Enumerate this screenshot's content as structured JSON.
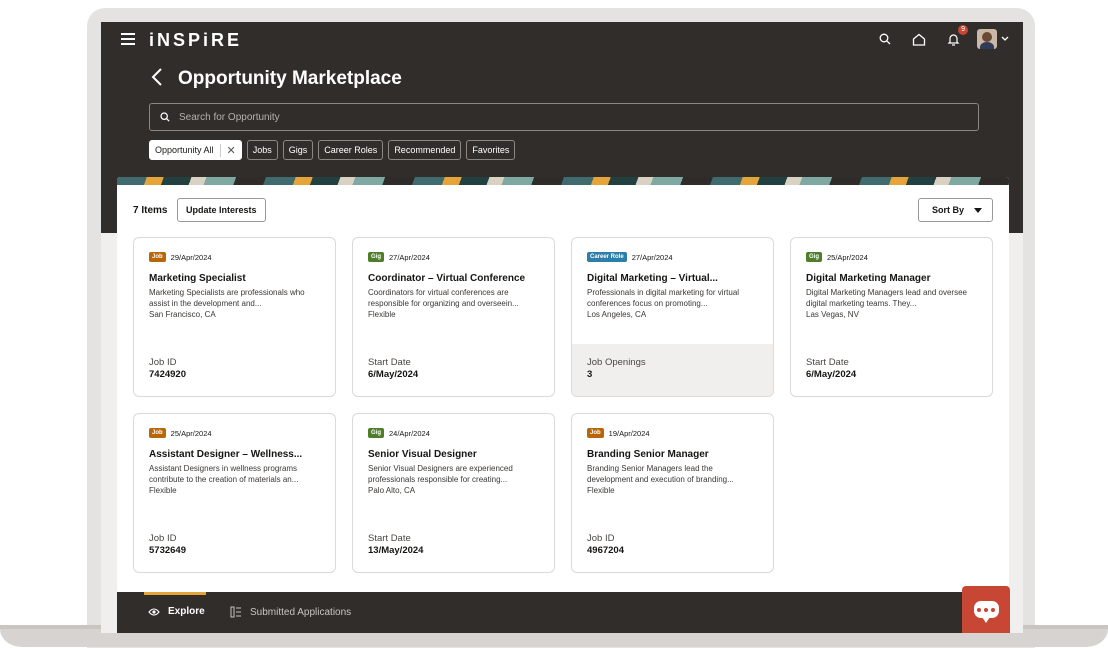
{
  "app": {
    "logo": "iNSPiRE"
  },
  "header": {
    "title": "Opportunity Marketplace",
    "notifications_count": "9"
  },
  "search": {
    "placeholder": "Search for Opportunity"
  },
  "filters": [
    {
      "label": "Opportunity All",
      "active": true
    },
    {
      "label": "Jobs",
      "active": false
    },
    {
      "label": "Gigs",
      "active": false
    },
    {
      "label": "Career Roles",
      "active": false
    },
    {
      "label": "Recommended",
      "active": false
    },
    {
      "label": "Favorites",
      "active": false
    }
  ],
  "toolbar": {
    "items_count": "7 Items",
    "update_label": "Update Interests",
    "sort_label": "Sort By"
  },
  "cards": [
    {
      "tag": "Job",
      "tag_type": "job",
      "date": "29/Apr/2024",
      "title": "Marketing Specialist",
      "desc": "Marketing Specialists are professionals who assist in the development and...",
      "location": "San Francisco, CA",
      "field_label": "Job ID",
      "field_value": "7424920",
      "shaded": false
    },
    {
      "tag": "Gig",
      "tag_type": "gig",
      "date": "27/Apr/2024",
      "title": "Coordinator – Virtual Conference",
      "desc": "Coordinators for virtual conferences are responsible for organizing and overseein...",
      "location": "Flexible",
      "field_label": "Start Date",
      "field_value": "6/May/2024",
      "shaded": false
    },
    {
      "tag": "Career Role",
      "tag_type": "career",
      "date": "27/Apr/2024",
      "title": "Digital Marketing – Virtual...",
      "desc": "Professionals in digital marketing for virtual conferences focus on promoting...",
      "location": "Los Angeles, CA",
      "field_label": "Job Openings",
      "field_value": "3",
      "shaded": true
    },
    {
      "tag": "Gig",
      "tag_type": "gig",
      "date": "25/Apr/2024",
      "title": "Digital Marketing Manager",
      "desc": "Digital Marketing Managers lead and oversee digital marketing teams. They...",
      "location": "Las Vegas, NV",
      "field_label": "Start Date",
      "field_value": "6/May/2024",
      "shaded": false
    },
    {
      "tag": "Job",
      "tag_type": "job",
      "date": "25/Apr/2024",
      "title": "Assistant Designer – Wellness...",
      "desc": "Assistant Designers in wellness programs contribute to the creation of materials an...",
      "location": "Flexible",
      "field_label": "Job ID",
      "field_value": "5732649",
      "shaded": false
    },
    {
      "tag": "Gig",
      "tag_type": "gig",
      "date": "24/Apr/2024",
      "title": "Senior Visual Designer",
      "desc": "Senior Visual Designers are experienced professionals responsible for creating...",
      "location": "Palo Alto, CA",
      "field_label": "Start Date",
      "field_value": "13/May/2024",
      "shaded": false
    },
    {
      "tag": "Job",
      "tag_type": "job",
      "date": "19/Apr/2024",
      "title": "Branding Senior Manager",
      "desc": "Branding Senior Managers lead the development and execution of branding...",
      "location": "Flexible",
      "field_label": "Job ID",
      "field_value": "4967204",
      "shaded": false
    }
  ],
  "bottom_nav": {
    "explore": "Explore",
    "submitted": "Submitted Applications"
  },
  "colors": {
    "header_bg": "#312d2a",
    "job_tag": "#b8660a",
    "gig_tag": "#4f7d2a",
    "career_tag": "#2d7ea8",
    "chat_button": "#c74634",
    "nav_indicator": "#e4a43a"
  },
  "icons": {
    "menu": "hamburger-icon",
    "search": "search-icon",
    "home": "home-icon",
    "notifications": "bell-icon",
    "back": "chevron-left-icon",
    "explore": "eye-icon",
    "submitted": "list-icon",
    "chat": "chat-icon"
  }
}
